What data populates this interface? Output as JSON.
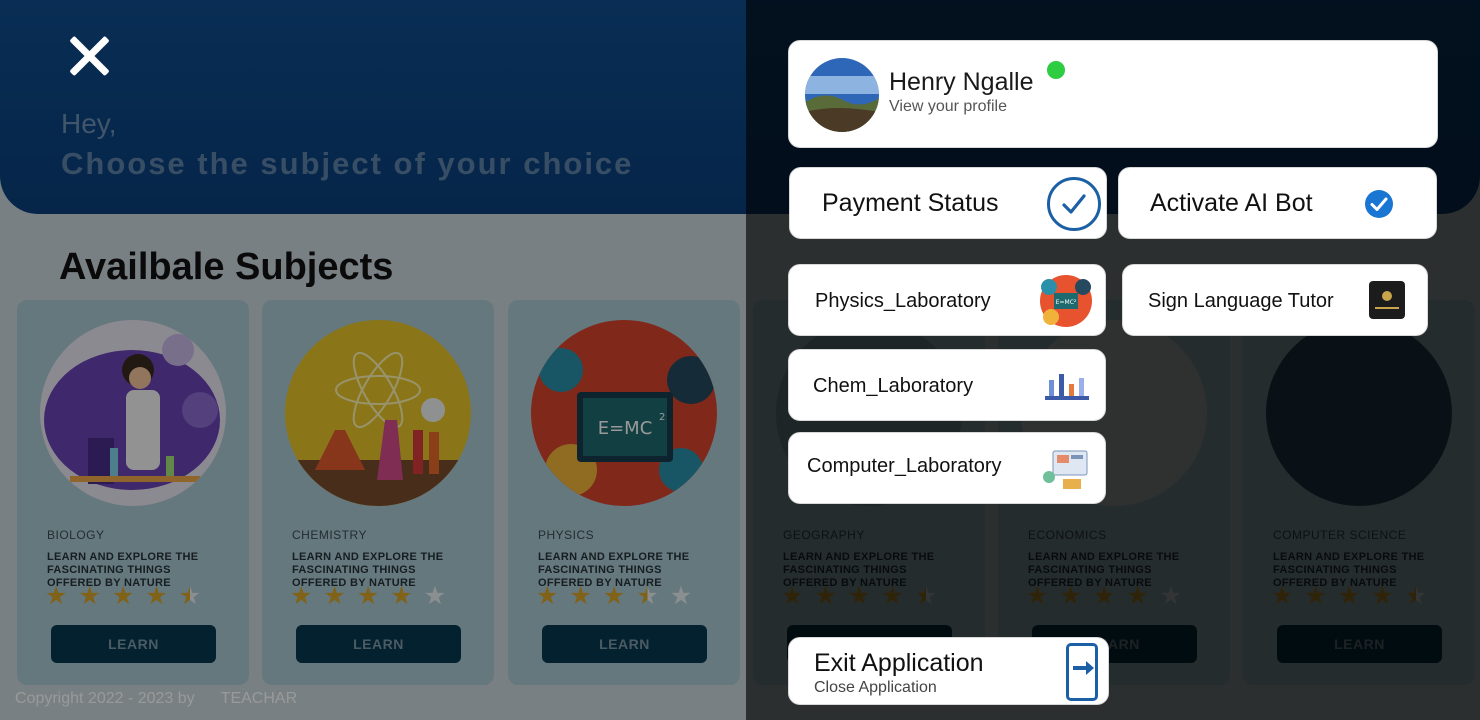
{
  "header": {
    "greeting": "Hey,",
    "headline": "Choose the subject of your choice"
  },
  "section_title": "Availbale Subjects",
  "cards": [
    {
      "category": "BIOLOGY",
      "description": "LEARN AND EXPLORE THE FASCINATING THINGS OFFERED BY NATURE",
      "rating": 4.5,
      "button": "LEARN"
    },
    {
      "category": "CHEMISTRY",
      "description": "LEARN AND EXPLORE THE FASCINATING THINGS OFFERED BY NATURE",
      "rating": 4,
      "button": "LEARN"
    },
    {
      "category": "PHYSICS",
      "description": "LEARN AND EXPLORE THE FASCINATING THINGS OFFERED BY NATURE",
      "rating": 3.5,
      "button": "LEARN"
    },
    {
      "category": "GEOGRAPHY",
      "description": "LEARN AND EXPLORE THE FASCINATING THINGS OFFERED BY NATURE",
      "rating": 4.5,
      "button": "LEARN"
    },
    {
      "category": "ECONOMICS",
      "description": "LEARN AND EXPLORE THE FASCINATING THINGS OFFERED BY NATURE",
      "rating": 4,
      "button": "LEARN"
    },
    {
      "category": "COMPUTER SCIENCE",
      "description": "LEARN AND EXPLORE THE FASCINATING THINGS OFFERED BY NATURE",
      "rating": 4.5,
      "button": "LEARN"
    }
  ],
  "footer": {
    "copyright": "Copyright 2022 - 2023 by",
    "brand": "TEACHAR"
  },
  "drawer": {
    "profile": {
      "name": "Henry Ngalle",
      "subtitle": "View your profile",
      "online": true
    },
    "payment_status": {
      "label": "Payment Status",
      "checked": true
    },
    "ai_bot": {
      "label": "Activate AI Bot",
      "checked": true
    },
    "labs": [
      {
        "label": "Physics_Laboratory",
        "icon": "physics-icon"
      },
      {
        "label": "Sign Language Tutor",
        "icon": "teachar-logo-icon"
      },
      {
        "label": "Chem_Laboratory",
        "icon": "chemistry-icon"
      },
      {
        "label": "Computer_Laboratory",
        "icon": "computer-icon"
      }
    ],
    "exit": {
      "title": "Exit Application",
      "subtitle": "Close Application"
    }
  },
  "colors": {
    "header_blue": "#0f4c8c",
    "button_dark": "#07384f",
    "star_gold": "#d6a32b",
    "online_green": "#2ecc40",
    "check_blue": "#1b5fa5"
  }
}
